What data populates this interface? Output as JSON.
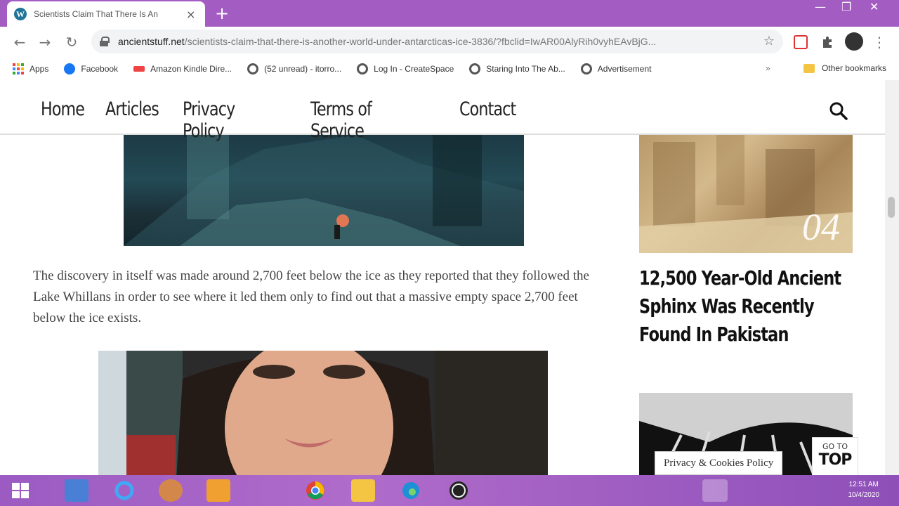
{
  "browser": {
    "tab_title": "Scientists Claim That There Is An",
    "tab_close": "×",
    "new_tab": "+",
    "url_host": "ancientstuff.net",
    "url_path": "/scientists-claim-that-there-is-another-world-under-antarcticas-ice-3836/?fbclid=IwAR00AlyRih0vyhEAvBjG...",
    "window_controls": {
      "minimize": "—",
      "maximize": "❐",
      "close": "✕"
    }
  },
  "bookmarks": [
    {
      "label": "Apps"
    },
    {
      "label": "Facebook",
      "color": "#1877f2"
    },
    {
      "label": "Amazon Kindle Dire...",
      "color": "#e44"
    },
    {
      "label": "(52 unread) - itorro...",
      "color": "#555"
    },
    {
      "label": "Log In - CreateSpace",
      "color": "#555"
    },
    {
      "label": "Staring Into The Ab...",
      "color": "#555"
    },
    {
      "label": "Advertisement",
      "color": "#555"
    }
  ],
  "bookmarks_more": "»",
  "other_bookmarks": "Other bookmarks",
  "site_nav": {
    "links": [
      "Home",
      "Articles",
      "Privacy Policy",
      "Terms of Service",
      "Contact"
    ]
  },
  "article": {
    "paragraph": "The discovery in itself was made around 2,700 feet below the ice as they reported that they followed the Lake Whillans in order to see where it led them only to find out that a massive empty space 2,700 feet below the ice exists."
  },
  "sidebar": {
    "number": "04",
    "title": "12,500 Year-Old Ancient Sphinx Was Recently Found In Pakistan"
  },
  "cookies_label": "Privacy & Cookies Policy",
  "go_to_top": {
    "small": "GO TO",
    "big": "TOP"
  },
  "taskbar": {
    "time": "12:51 AM",
    "date": "10/4/2020"
  }
}
